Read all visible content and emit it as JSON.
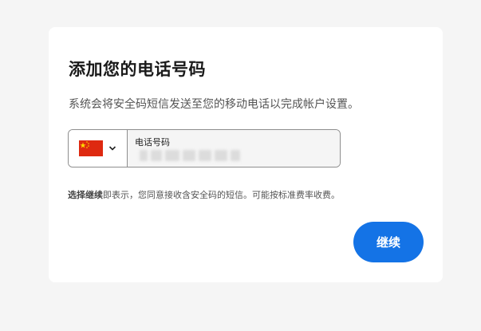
{
  "card": {
    "title": "添加您的电话号码",
    "subtitle": "系统会将安全码短信发送至您的移动电话以完成帐户设置。"
  },
  "phone": {
    "country_flag": "china-flag-icon",
    "field_label": "电话号码",
    "value_masked": true
  },
  "disclaimer": {
    "bold_part": "选择继续",
    "rest": "即表示，您同意接收含安全码的短信。可能按标准费率收费。"
  },
  "continue_button": {
    "label": "继续"
  },
  "colors": {
    "accent": "#1473e6",
    "card_bg": "#ffffff",
    "page_bg": "#f5f5f5",
    "flag_red": "#de2910",
    "flag_yellow": "#ffde00"
  }
}
